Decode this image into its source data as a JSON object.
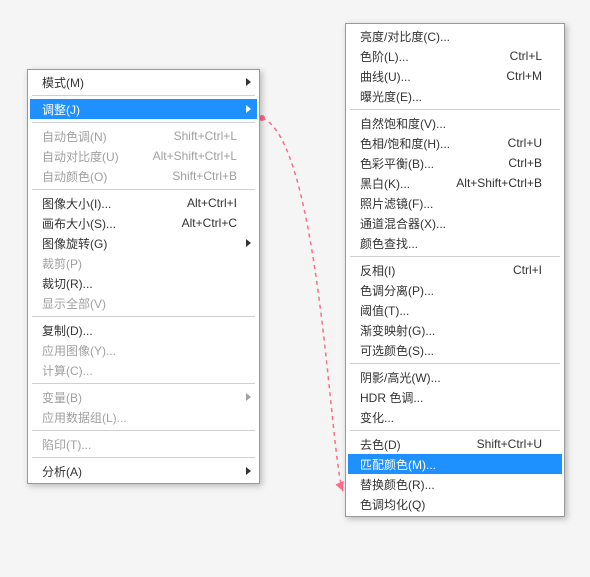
{
  "leftMenu": {
    "items": [
      {
        "label": "模式(M)",
        "submenu": true
      },
      {
        "sep": true
      },
      {
        "label": "调整(J)",
        "submenu": true,
        "highlight": true
      },
      {
        "sep": true
      },
      {
        "label": "自动色调(N)",
        "shortcut": "Shift+Ctrl+L",
        "disabled": true
      },
      {
        "label": "自动对比度(U)",
        "shortcut": "Alt+Shift+Ctrl+L",
        "disabled": true
      },
      {
        "label": "自动颜色(O)",
        "shortcut": "Shift+Ctrl+B",
        "disabled": true
      },
      {
        "sep": true
      },
      {
        "label": "图像大小(I)...",
        "shortcut": "Alt+Ctrl+I"
      },
      {
        "label": "画布大小(S)...",
        "shortcut": "Alt+Ctrl+C"
      },
      {
        "label": "图像旋转(G)",
        "submenu": true
      },
      {
        "label": "裁剪(P)",
        "disabled": true
      },
      {
        "label": "裁切(R)..."
      },
      {
        "label": "显示全部(V)",
        "disabled": true
      },
      {
        "sep": true
      },
      {
        "label": "复制(D)..."
      },
      {
        "label": "应用图像(Y)...",
        "disabled": true
      },
      {
        "label": "计算(C)...",
        "disabled": true
      },
      {
        "sep": true
      },
      {
        "label": "变量(B)",
        "submenu": true,
        "disabled": true
      },
      {
        "label": "应用数据组(L)...",
        "disabled": true
      },
      {
        "sep": true
      },
      {
        "label": "陷印(T)...",
        "disabled": true
      },
      {
        "sep": true
      },
      {
        "label": "分析(A)",
        "submenu": true
      }
    ]
  },
  "rightMenu": {
    "items": [
      {
        "label": "亮度/对比度(C)..."
      },
      {
        "label": "色阶(L)...",
        "shortcut": "Ctrl+L"
      },
      {
        "label": "曲线(U)...",
        "shortcut": "Ctrl+M"
      },
      {
        "label": "曝光度(E)..."
      },
      {
        "sep": true
      },
      {
        "label": "自然饱和度(V)..."
      },
      {
        "label": "色相/饱和度(H)...",
        "shortcut": "Ctrl+U"
      },
      {
        "label": "色彩平衡(B)...",
        "shortcut": "Ctrl+B"
      },
      {
        "label": "黑白(K)...",
        "shortcut": "Alt+Shift+Ctrl+B"
      },
      {
        "label": "照片滤镜(F)..."
      },
      {
        "label": "通道混合器(X)..."
      },
      {
        "label": "颜色查找..."
      },
      {
        "sep": true
      },
      {
        "label": "反相(I)",
        "shortcut": "Ctrl+I"
      },
      {
        "label": "色调分离(P)..."
      },
      {
        "label": "阈值(T)..."
      },
      {
        "label": "渐变映射(G)..."
      },
      {
        "label": "可选颜色(S)..."
      },
      {
        "sep": true
      },
      {
        "label": "阴影/高光(W)..."
      },
      {
        "label": "HDR 色调..."
      },
      {
        "label": "变化..."
      },
      {
        "sep": true
      },
      {
        "label": "去色(D)",
        "shortcut": "Shift+Ctrl+U"
      },
      {
        "label": "匹配颜色(M)...",
        "highlight": true
      },
      {
        "label": "替换颜色(R)..."
      },
      {
        "label": "色调均化(Q)"
      }
    ]
  }
}
